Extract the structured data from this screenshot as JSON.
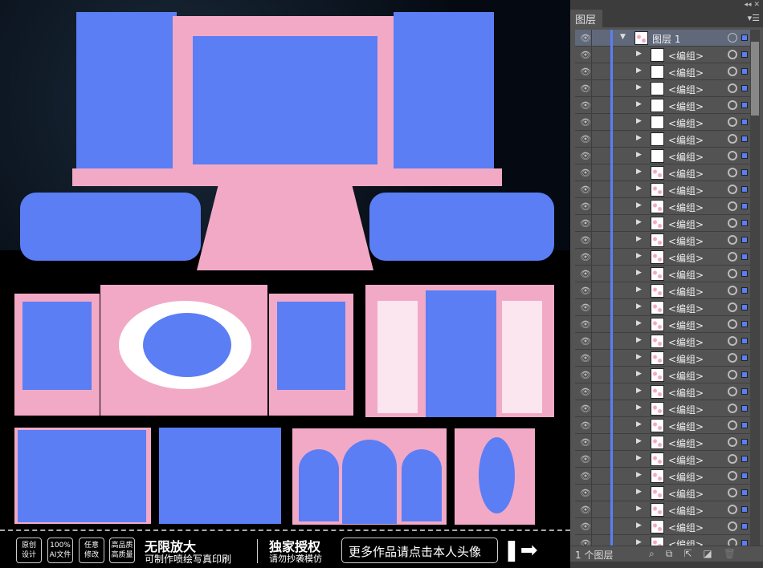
{
  "panel": {
    "tab_label": "图层",
    "layer": {
      "name": "图层 1"
    },
    "group_rows": [
      {
        "name": "<编组>",
        "thumb": "white"
      },
      {
        "name": "<编组>",
        "thumb": "white"
      },
      {
        "name": "<编组>",
        "thumb": "white"
      },
      {
        "name": "<编组>",
        "thumb": "white"
      },
      {
        "name": "<编组>",
        "thumb": "white"
      },
      {
        "name": "<编组>",
        "thumb": "white"
      },
      {
        "name": "<编组>",
        "thumb": "white"
      },
      {
        "name": "<编组>",
        "thumb": "pink"
      },
      {
        "name": "<编组>",
        "thumb": "pink"
      },
      {
        "name": "<编组>",
        "thumb": "pink"
      },
      {
        "name": "<编组>",
        "thumb": "pink"
      },
      {
        "name": "<编组>",
        "thumb": "pink"
      },
      {
        "name": "<编组>",
        "thumb": "pink"
      },
      {
        "name": "<编组>",
        "thumb": "pink"
      },
      {
        "name": "<编组>",
        "thumb": "pink"
      },
      {
        "name": "<编组>",
        "thumb": "pink"
      },
      {
        "name": "<编组>",
        "thumb": "pink"
      },
      {
        "name": "<编组>",
        "thumb": "pink"
      },
      {
        "name": "<编组>",
        "thumb": "pink"
      },
      {
        "name": "<编组>",
        "thumb": "pink"
      },
      {
        "name": "<编组>",
        "thumb": "pink"
      },
      {
        "name": "<编组>",
        "thumb": "pink"
      },
      {
        "name": "<编组>",
        "thumb": "pink"
      },
      {
        "name": "<编组>",
        "thumb": "pink"
      },
      {
        "name": "<编组>",
        "thumb": "pink"
      },
      {
        "name": "<编组>",
        "thumb": "pink"
      },
      {
        "name": "<编组>",
        "thumb": "pink"
      },
      {
        "name": "<编组>",
        "thumb": "pink"
      },
      {
        "name": "<编组>",
        "thumb": "pink"
      },
      {
        "name": "<编组>",
        "thumb": "pink"
      }
    ],
    "footer_count": "1 个图层",
    "selection_color": "#5b7ef5"
  },
  "banner": {
    "badges": [
      "原创\n设计",
      "100%\nAI文件",
      "任意\n修改",
      "高品质\n高质量"
    ],
    "title1": "无限放大",
    "sub1": "可制作喷绘写真印刷",
    "title2": "独家授权",
    "sub2": "请勿抄袭模仿",
    "cta": "更多作品请点击本人头像"
  }
}
